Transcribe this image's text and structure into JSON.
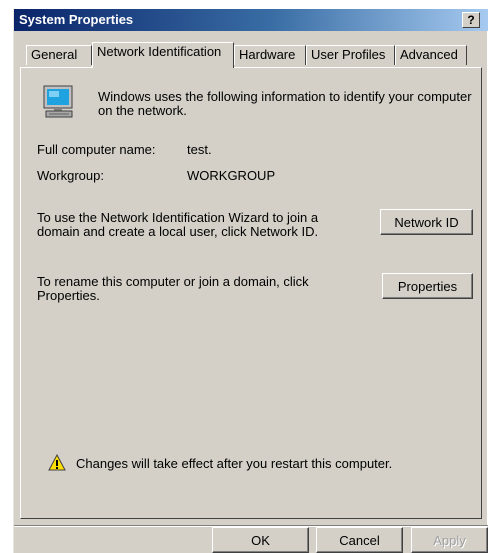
{
  "window": {
    "title": "System Properties",
    "help_label": "?"
  },
  "tabs": [
    {
      "label": "General"
    },
    {
      "label": "Network Identification"
    },
    {
      "label": "Hardware"
    },
    {
      "label": "User Profiles"
    },
    {
      "label": "Advanced"
    }
  ],
  "panel": {
    "intro_line1": "Windows uses the following information to identify your computer",
    "intro_line2": "on the network.",
    "full_name_label": "Full computer name:",
    "full_name_value": "test.",
    "workgroup_label": "Workgroup:",
    "workgroup_value": "WORKGROUP",
    "netid_text1": "To use the Network Identification Wizard to join a",
    "netid_text2": "domain and create a local user, click Network ID.",
    "netid_button": "Network ID",
    "rename_text1": "To rename this computer or join a domain, click",
    "rename_text2": "Properties.",
    "properties_button": "Properties",
    "warning_text": "Changes will take effect after you restart this computer."
  },
  "footer": {
    "ok_label": "OK",
    "cancel_label": "Cancel",
    "apply_label": "Apply"
  },
  "icons": {
    "computer": "computer-monitor-icon",
    "warning": "warning-triangle-icon"
  },
  "colors": {
    "face": "#d4d0c8",
    "title_start": "#0a246a",
    "title_end": "#a6caf0"
  }
}
